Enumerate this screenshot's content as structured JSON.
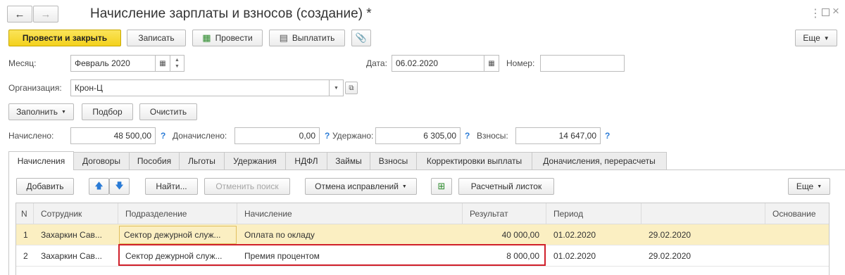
{
  "window": {
    "title": "Начисление зарплаты и взносов (создание) *"
  },
  "toolbar": {
    "post_close": "Провести и закрыть",
    "save": "Записать",
    "post": "Провести",
    "pay": "Выплатить",
    "more": "Еще"
  },
  "form": {
    "month_label": "Месяц:",
    "month_value": "Февраль 2020",
    "date_label": "Дата:",
    "date_value": "06.02.2020",
    "number_label": "Номер:",
    "number_value": "",
    "org_label": "Организация:",
    "org_value": "Крон-Ц"
  },
  "actions": {
    "fill": "Заполнить",
    "pick": "Подбор",
    "clear": "Очистить"
  },
  "totals": {
    "accrued_label": "Начислено:",
    "accrued_value": "48 500,00",
    "extra_label": "Доначислено:",
    "extra_value": "0,00",
    "withheld_label": "Удержано:",
    "withheld_value": "6 305,00",
    "contrib_label": "Взносы:",
    "contrib_value": "14 647,00",
    "help": "?"
  },
  "tabs": [
    {
      "label": "Начисления"
    },
    {
      "label": "Договоры"
    },
    {
      "label": "Пособия"
    },
    {
      "label": "Льготы"
    },
    {
      "label": "Удержания"
    },
    {
      "label": "НДФЛ"
    },
    {
      "label": "Займы"
    },
    {
      "label": "Взносы"
    },
    {
      "label": "Корректировки выплаты"
    },
    {
      "label": "Доначисления, перерасчеты"
    }
  ],
  "grid_toolbar": {
    "add": "Добавить",
    "find": "Найти...",
    "cancel_search": "Отменить поиск",
    "corrections": "Отмена исправлений",
    "payslip": "Расчетный листок",
    "more": "Еще"
  },
  "table": {
    "columns": [
      "N",
      "Сотрудник",
      "Подразделение",
      "Начисление",
      "Результат",
      "Период",
      "",
      "Основание"
    ],
    "rows": [
      {
        "n": "1",
        "employee": "Захаркин Сав...",
        "department": "Сектор дежурной служ...",
        "accrual": "Оплата по окладу",
        "result": "40 000,00",
        "from": "01.02.2020",
        "to": "29.02.2020",
        "basis": ""
      },
      {
        "n": "2",
        "employee": "Захаркин Сав...",
        "department": "Сектор дежурной служ...",
        "accrual": "Премия процентом",
        "result": "8 000,00",
        "from": "01.02.2020",
        "to": "29.02.2020",
        "basis": ""
      }
    ]
  },
  "colors": {
    "primary_button": "#f3d11d",
    "selected_row": "#fbefc2",
    "highlight_border": "#d0202a",
    "help_icon": "#2a7bd6"
  }
}
